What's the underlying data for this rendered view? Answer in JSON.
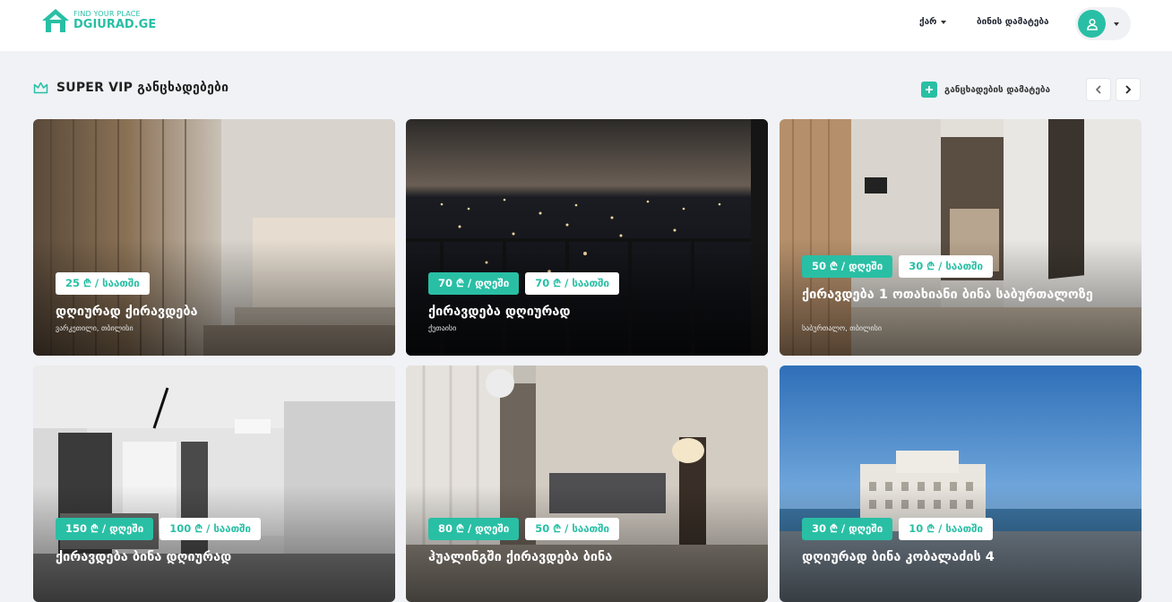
{
  "colors": {
    "accent": "#29bfa5",
    "page_bg": "#f1f2f6",
    "header_bg": "#ffffff"
  },
  "header": {
    "logo_tagline": "FIND YOUR PLACE",
    "logo_name": "DGIURAD.GE",
    "language": "ქარ",
    "add_flat": "ბინის დამატება",
    "profile_icon": "user-icon"
  },
  "section": {
    "title": "SUPER VIP განცხადებები",
    "icon": "crown-icon",
    "add_listing": "განცხადების დამატება"
  },
  "listings": [
    {
      "badges": [
        "25 ₾ / საათში"
      ],
      "badge_styles": [
        "white"
      ],
      "title": "დღიურად ქირავდება",
      "location": "ვარკეთილი, თბილისი"
    },
    {
      "badges": [
        "70 ₾ / დღეში",
        "70 ₾ / საათში"
      ],
      "badge_styles": [
        "green",
        "white"
      ],
      "title": "ქირავდება დღიურად",
      "location": "ქუთაისი"
    },
    {
      "badges": [
        "50 ₾ / დღეში",
        "30 ₾ / საათში"
      ],
      "badge_styles": [
        "green",
        "white"
      ],
      "title": "ქირავდება 1 ოთახიანი ბინა საბურთალოზე",
      "location": "საბურთალო, თბილისი"
    },
    {
      "badges": [
        "150 ₾ / დღეში",
        "100 ₾ / საათში"
      ],
      "badge_styles": [
        "green",
        "white"
      ],
      "title": "ქირავდება ბინა დღიურად",
      "location": ""
    },
    {
      "badges": [
        "80 ₾ / დღეში",
        "50 ₾ / საათში"
      ],
      "badge_styles": [
        "green",
        "white"
      ],
      "title": "ჰუალინგში ქირავდება ბინა",
      "location": ""
    },
    {
      "badges": [
        "30 ₾ / დღეში",
        "10 ₾ / საათში"
      ],
      "badge_styles": [
        "green",
        "white"
      ],
      "title": "დღიურად ბინა კობალაძის 4",
      "location": ""
    }
  ]
}
